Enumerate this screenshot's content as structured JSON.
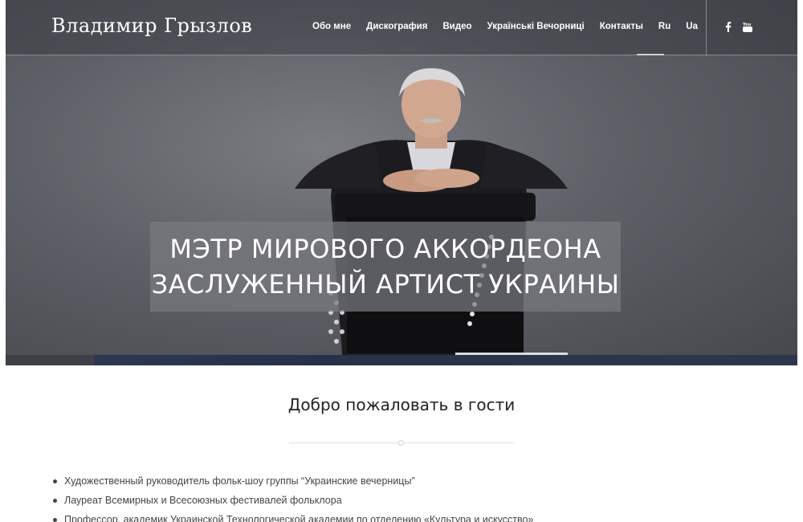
{
  "header": {
    "logo": "Владимир Грызлов",
    "nav": [
      {
        "label": "Обо мне"
      },
      {
        "label": "Дискография"
      },
      {
        "label": "Видео"
      },
      {
        "label": "Українські Вечорниці"
      },
      {
        "label": "Контакты"
      },
      {
        "label": "Ru"
      },
      {
        "label": "Ua"
      }
    ],
    "social": [
      "facebook-icon",
      "youtube-icon"
    ]
  },
  "hero": {
    "line1": "МЭТР МИРОВОГО АККОРДЕОНА",
    "line2": "ЗАСЛУЖЕННЫЙ АРТИСТ УКРАИНЫ"
  },
  "welcome": {
    "title": "Добро пожаловать в гости",
    "bullets": [
      "Художественный руководитель фольк-шоу группы “Украинские вечерницы”",
      "Лауреат Всемирных и Всесоюзных фестивалей фольклора",
      "Профессор, академик Украинской Технологической академии по отделению «Культура и искусство»"
    ]
  }
}
